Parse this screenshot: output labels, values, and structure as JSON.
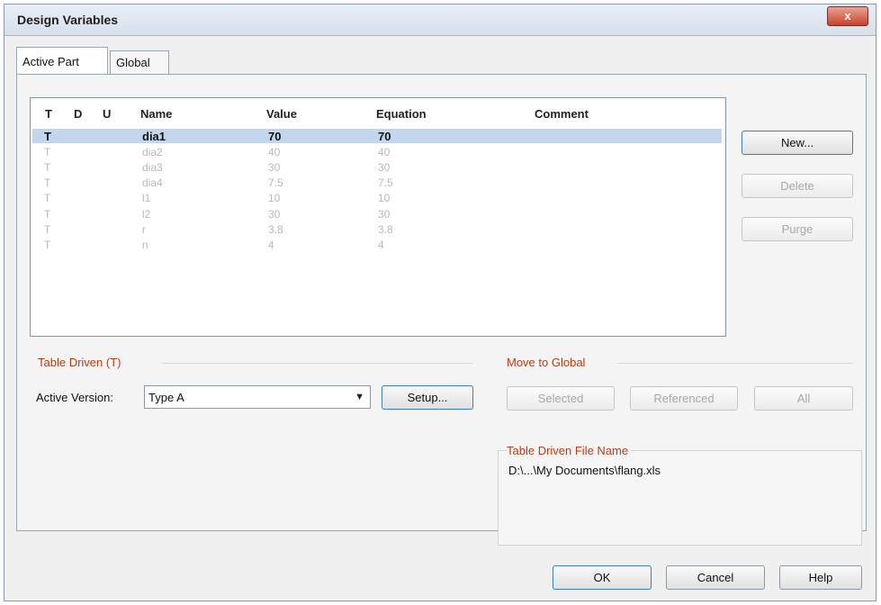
{
  "window": {
    "title": "Design Variables",
    "close_label": "x"
  },
  "tabs": [
    {
      "label": "Active Part"
    },
    {
      "label": "Global"
    }
  ],
  "table": {
    "headers": {
      "t": "T",
      "d": "D",
      "u": "U",
      "name": "Name",
      "value": "Value",
      "equation": "Equation",
      "comment": "Comment"
    },
    "rows": [
      {
        "t": "T",
        "name": "dia1",
        "value": "70",
        "equation": "70"
      },
      {
        "t": "T",
        "name": "dia2",
        "value": "40",
        "equation": "40"
      },
      {
        "t": "T",
        "name": "dia3",
        "value": "30",
        "equation": "30"
      },
      {
        "t": "T",
        "name": "dia4",
        "value": "7.5",
        "equation": "7.5"
      },
      {
        "t": "T",
        "name": "l1",
        "value": "10",
        "equation": "10"
      },
      {
        "t": "T",
        "name": "l2",
        "value": "30",
        "equation": "30"
      },
      {
        "t": "T",
        "name": "r",
        "value": "3.8",
        "equation": "3.8"
      },
      {
        "t": "T",
        "name": "n",
        "value": "4",
        "equation": "4"
      }
    ]
  },
  "side_buttons": {
    "new": "New...",
    "delete": "Delete",
    "purge": "Purge"
  },
  "table_driven": {
    "label": "Table Driven (T)",
    "active_version_label": "Active Version:",
    "active_version_value": "Type A",
    "setup": "Setup..."
  },
  "move_to_global": {
    "label": "Move to Global",
    "selected": "Selected",
    "referenced": "Referenced",
    "all": "All"
  },
  "file": {
    "label": "Table Driven File Name",
    "path": "D:\\...\\My Documents\\flang.xls"
  },
  "footer": {
    "ok": "OK",
    "cancel": "Cancel",
    "help": "Help"
  }
}
